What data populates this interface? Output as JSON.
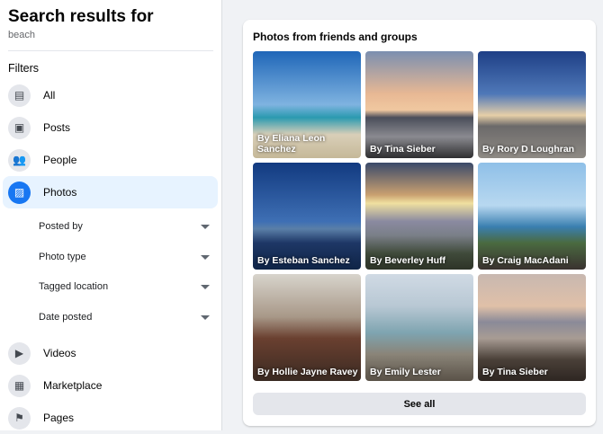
{
  "sidebar": {
    "title": "Search results for",
    "query": "beach",
    "filters_label": "Filters",
    "items": [
      {
        "label": "All",
        "icon": "feed-icon"
      },
      {
        "label": "Posts",
        "icon": "posts-icon"
      },
      {
        "label": "People",
        "icon": "people-icon"
      },
      {
        "label": "Photos",
        "icon": "photos-icon"
      },
      {
        "label": "Videos",
        "icon": "video-icon"
      },
      {
        "label": "Marketplace",
        "icon": "shop-icon"
      },
      {
        "label": "Pages",
        "icon": "flag-icon"
      }
    ],
    "sub_filters": [
      "Posted by",
      "Photo type",
      "Tagged location",
      "Date posted"
    ]
  },
  "main": {
    "card_title": "Photos from friends and groups",
    "photos": [
      "By Eliana Leon Sanchez",
      "By Tina Sieber",
      "By Rory D Loughran",
      "By Esteban Sanchez",
      "By Beverley Huff",
      "By Craig MacAdani",
      "By Hollie Jayne Ravey",
      "By Emily Lester",
      "By Tina Sieber"
    ],
    "see_all": "See all"
  },
  "colors": {
    "accent": "#1877f2",
    "active_bg": "#e7f3ff"
  }
}
